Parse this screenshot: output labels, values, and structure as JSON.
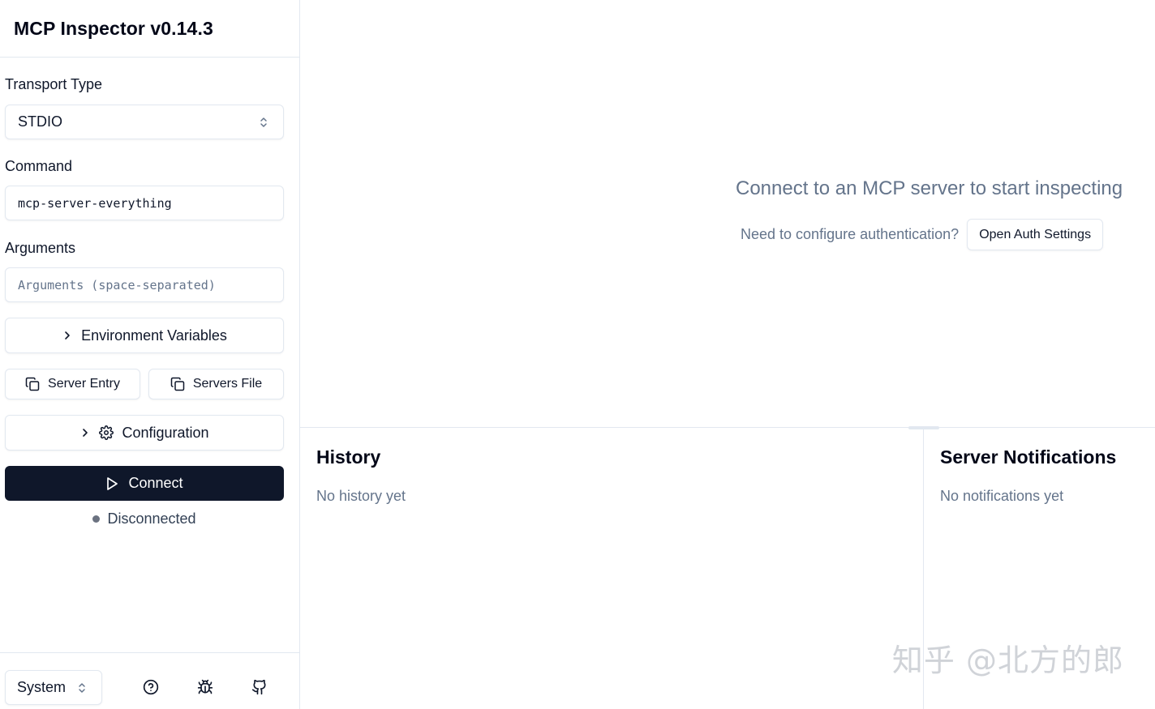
{
  "app": {
    "title": "MCP Inspector v0.14.3"
  },
  "sidebar": {
    "transport": {
      "label": "Transport Type",
      "value": "STDIO"
    },
    "command": {
      "label": "Command",
      "value": "mcp-server-everything"
    },
    "arguments": {
      "label": "Arguments",
      "value": "",
      "placeholder": "Arguments (space-separated)"
    },
    "env_button": "Environment Variables",
    "server_entry_button": "Server Entry",
    "servers_file_button": "Servers File",
    "config_button": "Configuration",
    "connect_button": "Connect",
    "status": {
      "text": "Disconnected",
      "color": "#6b7280"
    },
    "footer": {
      "theme_value": "System"
    }
  },
  "main": {
    "empty_title": "Connect to an MCP server to start inspecting",
    "auth_prompt": "Need to configure authentication?",
    "auth_button": "Open Auth Settings",
    "history": {
      "title": "History",
      "empty": "No history yet"
    },
    "notifications": {
      "title": "Server Notifications",
      "empty": "No notifications yet"
    }
  },
  "watermark": "知乎 @北方的郎",
  "colors": {
    "primary": "#0f172a",
    "border": "#e2e8f0",
    "muted": "#64748b"
  }
}
